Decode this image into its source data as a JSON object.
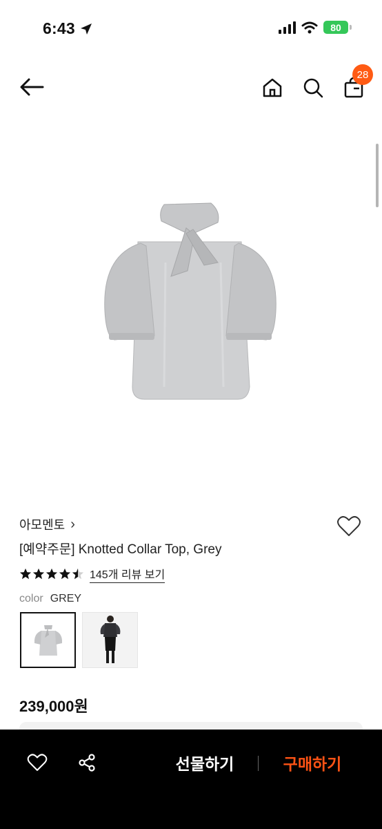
{
  "status_bar": {
    "time": "6:43",
    "battery": "80"
  },
  "header": {
    "cart_count": "28"
  },
  "product": {
    "brand": "아모멘토",
    "brand_chevron": "›",
    "title": "[예약주문] Knotted Collar Top, Grey",
    "rating": 4.5,
    "review_link": "145개 리뷰 보기",
    "color_label": "color",
    "color_value": "GREY",
    "price": "239,000원"
  },
  "bottom_bar": {
    "gift_label": "선물하기",
    "buy_label": "구매하기"
  },
  "colors": {
    "accent": "#ff5315",
    "badge": "#ff5b14",
    "battery": "#35c759"
  }
}
